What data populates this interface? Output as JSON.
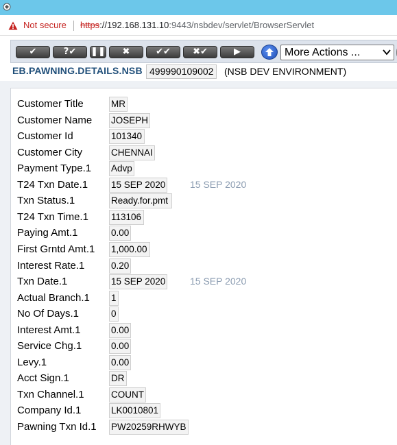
{
  "browser": {
    "security_label": "Not secure",
    "url_scheme": "https",
    "url_host": "://192.168.131.10",
    "url_rest": ":9443/nsbdev/servlet/BrowserServlet"
  },
  "toolbar": {
    "buttons": [
      {
        "name": "commit-button",
        "glyph": "✔"
      },
      {
        "name": "validate-button",
        "glyph": "?✔"
      },
      {
        "name": "hold-button",
        "glyph": "❚❚"
      },
      {
        "name": "delete-button",
        "glyph": "✖"
      },
      {
        "name": "authorise-button",
        "glyph": "✔✔"
      },
      {
        "name": "reverse-button",
        "glyph": "✖✔"
      },
      {
        "name": "next-button",
        "glyph": "▶"
      }
    ],
    "actions_select": "More Actions ..."
  },
  "header": {
    "app_title": "EB.PAWNING.DETAILS.NSB",
    "record_id": "499990109002",
    "environment": "(NSB DEV ENVIRONMENT)"
  },
  "fields": [
    {
      "label": "Customer Title",
      "value": "MR"
    },
    {
      "label": "Customer Name",
      "value": "JOSEPH"
    },
    {
      "label": "Customer Id",
      "value": "101340"
    },
    {
      "label": "Customer City",
      "value": "CHENNAI"
    },
    {
      "label": "Payment Type.1",
      "value": "Advp"
    },
    {
      "label": "T24 Txn Date.1",
      "value": "15 SEP 2020",
      "enrichment": "15 SEP 2020"
    },
    {
      "label": "Txn Status.1",
      "value": "Ready.for.pmt"
    },
    {
      "label": "T24 Txn Time.1",
      "value": "113106"
    },
    {
      "label": "Paying Amt.1",
      "value": "0.00"
    },
    {
      "label": "First Grntd Amt.1",
      "value": "1,000.00"
    },
    {
      "label": "Interest Rate.1",
      "value": "0.20"
    },
    {
      "label": "Txn Date.1",
      "value": "15 SEP 2020",
      "enrichment": "15 SEP 2020"
    },
    {
      "label": "Actual Branch.1",
      "value": "1"
    },
    {
      "label": "No Of Days.1",
      "value": "0"
    },
    {
      "label": "Interest Amt.1",
      "value": "0.00"
    },
    {
      "label": "Service Chg.1",
      "value": "0.00"
    },
    {
      "label": "Levy.1",
      "value": "0.00"
    },
    {
      "label": "Acct Sign.1",
      "value": "DR"
    },
    {
      "label": "Txn Channel.1",
      "value": "COUNT"
    },
    {
      "label": "Company Id.1",
      "value": "LK0010801"
    },
    {
      "label": "Pawning Txn Id.1",
      "value": "PW20259RHWYB"
    }
  ],
  "colors": {
    "titlebar": "#6cc7ea",
    "app_title": "#1f4e79",
    "not_secure": "#c5221f",
    "enrichment": "#8a9bb0"
  }
}
